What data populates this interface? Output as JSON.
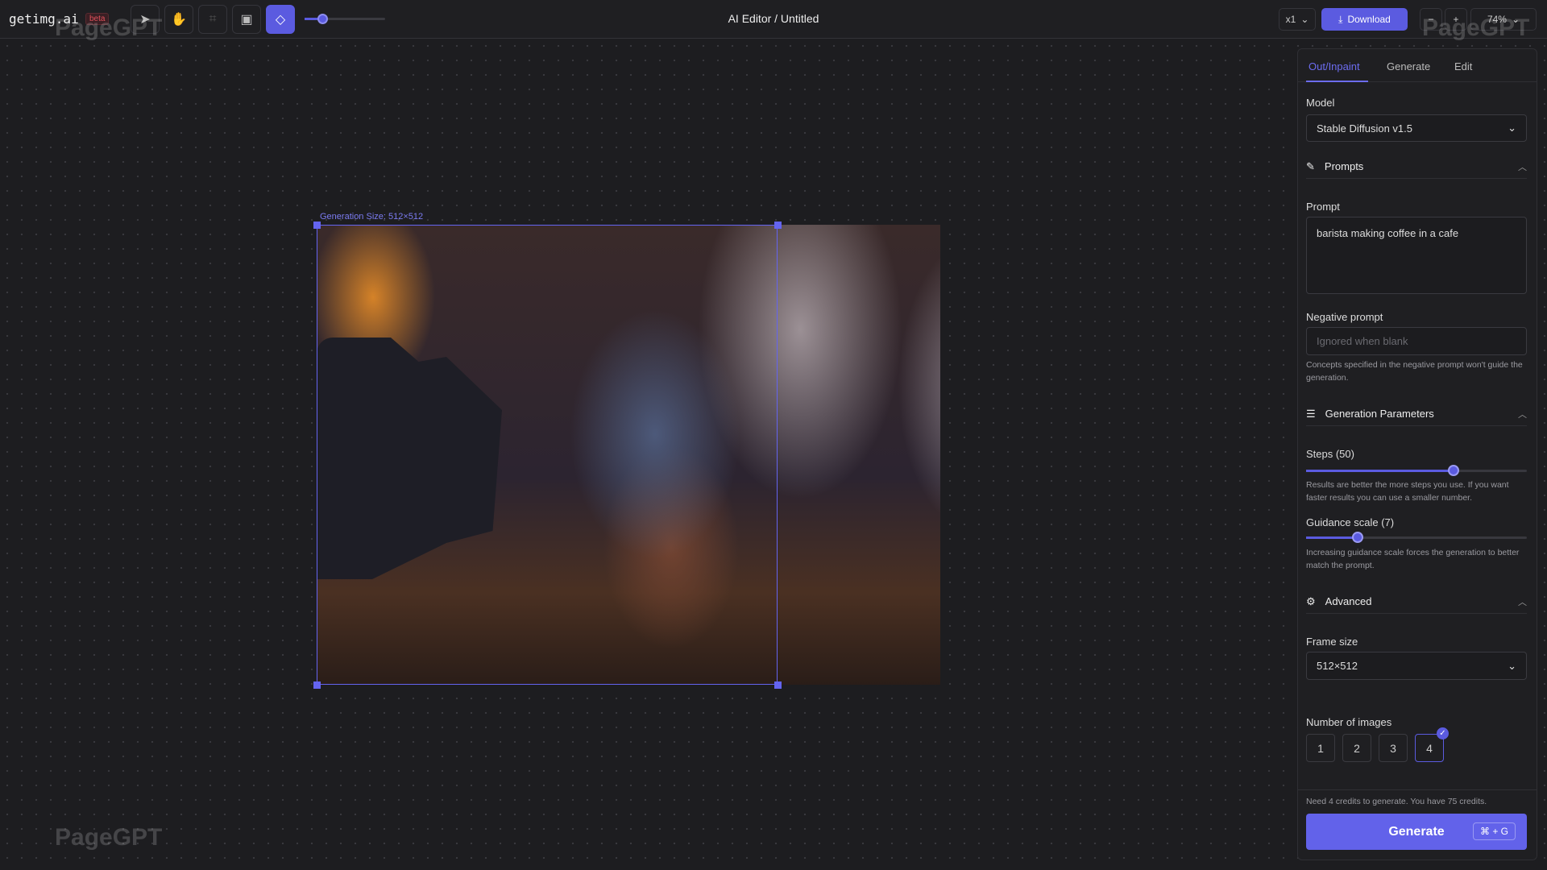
{
  "app": {
    "logo": "getimg.ai",
    "badge": "beta",
    "title": "AI Editor / Untitled"
  },
  "toolbar": {
    "tools": [
      "select-icon",
      "hand-icon",
      "focus-icon",
      "image-icon",
      "eraser-icon"
    ],
    "active_tool": "eraser",
    "brush_size_fraction": 0.22,
    "batch": "x1",
    "download": "Download",
    "zoom_out": "−",
    "zoom_in": "+",
    "zoom": "74%"
  },
  "canvas": {
    "generation_label": "Generation Size: 512×512",
    "accent": "#6464f0"
  },
  "panel": {
    "tabs": [
      {
        "label": "Out/Inpaint",
        "active": true
      },
      {
        "label": "Generate"
      },
      {
        "label": "Edit"
      }
    ],
    "model_label": "Model",
    "model": "Stable Diffusion v1.5",
    "prompts_section": "Prompts",
    "prompt_label": "Prompt",
    "prompt": "barista making coffee in a cafe",
    "negative_label": "Negative prompt",
    "negative_placeholder": "Ignored when blank",
    "negative_help": "Concepts specified in the negative prompt won't guide the generation.",
    "params_section": "Generation Parameters",
    "steps_label": "Steps (50)",
    "steps": 50,
    "steps_help": "Results are better the more steps you use. If you want faster results you can use a smaller number.",
    "guidance_label": "Guidance scale (7)",
    "guidance": 7,
    "guidance_help": "Increasing guidance scale forces the generation to better match the prompt.",
    "advanced_section": "Advanced",
    "frame_label": "Frame size",
    "frame": "512×512",
    "images_label": "Number of images",
    "images_options": [
      "1",
      "2",
      "3",
      "4"
    ],
    "images_selected": "4",
    "credits": "Need 4 credits to generate. You have 75 credits.",
    "generate": "Generate",
    "shortcut": "⌘ + G"
  },
  "watermark": "PageGPT",
  "brand_color": "#5b5be0"
}
